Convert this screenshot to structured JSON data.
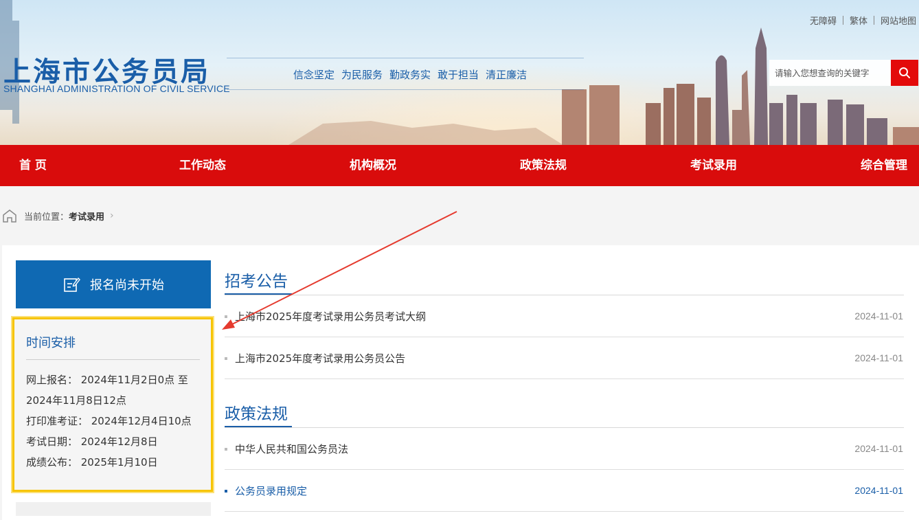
{
  "header": {
    "logo_cn": "上海市公务员局",
    "logo_en": "SHANGHAI ADMINISTRATION OF CIVIL SERVICE",
    "motto": [
      "信念坚定",
      "为民服务",
      "勤政务实",
      "敢于担当",
      "清正廉洁"
    ],
    "top_links": [
      "无障碍",
      "繁体",
      "网站地图"
    ],
    "search_placeholder": "请输入您想查询的关键字",
    "search_icon": "search-icon"
  },
  "nav": [
    "首 页",
    "工作动态",
    "机构概况",
    "政策法规",
    "考试录用",
    "综合管理"
  ],
  "breadcrumb": {
    "prefix": "当前位置：",
    "current": "考试录用"
  },
  "sidebar": {
    "register_button": "报名尚未开始",
    "schedule": {
      "title": "时间安排",
      "lines": [
        "网上报名：  2024年11月2日0点 至",
        "2024年11月8日12点",
        "打印准考证：  2024年12月4日10点",
        "考试日期：  2024年12月8日",
        "成绩公布：  2025年1月10日"
      ]
    }
  },
  "sections": [
    {
      "title": "招考公告",
      "items": [
        {
          "text": "上海市2025年度考试录用公务员考试大纲",
          "date": "2024-11-01"
        },
        {
          "text": "上海市2025年度考试录用公务员公告",
          "date": "2024-11-01"
        }
      ]
    },
    {
      "title": "政策法规",
      "items": [
        {
          "text": "中华人民共和国公务员法",
          "date": "2024-11-01"
        },
        {
          "text": "公务员录用规定",
          "date": "2024-11-01"
        }
      ]
    }
  ],
  "colors": {
    "brand_blue": "#1a5ea8",
    "nav_red": "#d90c0c",
    "highlight_yellow": "#f7c400",
    "arrow_red": "#e53a2e"
  }
}
